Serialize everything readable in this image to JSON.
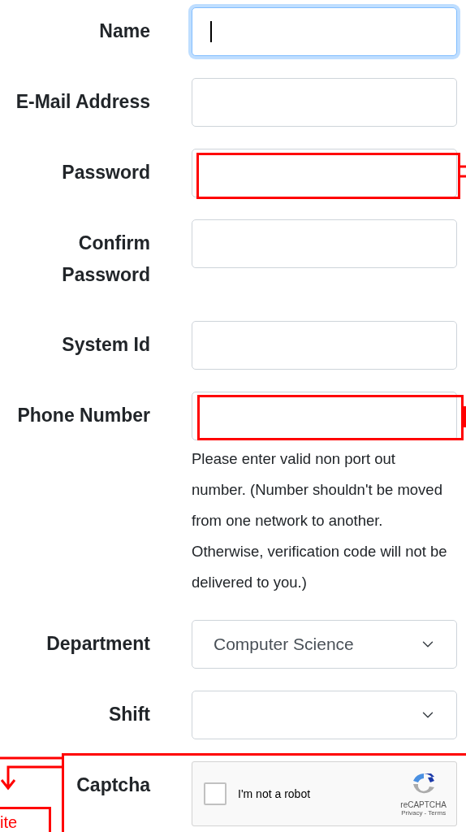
{
  "fields": [
    {
      "kind": "text",
      "label": "Name",
      "focused": true
    },
    {
      "kind": "text",
      "label": "E-Mail Address",
      "focused": false
    },
    {
      "kind": "text",
      "label": "Password",
      "focused": false
    },
    {
      "kind": "text",
      "label": "Confirm Password",
      "focused": false
    },
    {
      "kind": "text",
      "label": "System Id",
      "focused": false
    },
    {
      "kind": "text",
      "label": "Phone Number",
      "focused": false,
      "help": "Please enter valid non port out number. (Number shouldn't be moved from one network to another. Otherwise, verification code will not be delivered to you.)"
    },
    {
      "kind": "select",
      "label": "Department",
      "value": "Computer Science"
    },
    {
      "kind": "select",
      "label": "Shift"
    },
    {
      "kind": "captcha",
      "label": "Captcha",
      "checked": false,
      "checkbox_label": "I'm not a robot",
      "brand": "reCAPTCHA",
      "links": "Privacy - Terms"
    }
  ],
  "annotation_note": "ite"
}
